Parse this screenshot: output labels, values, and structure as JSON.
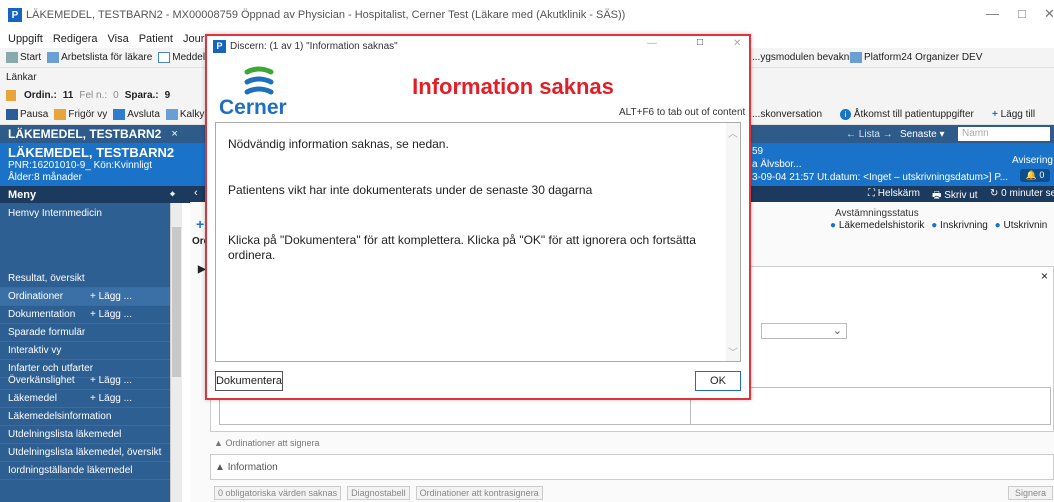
{
  "window": {
    "title": "LÄKEMEDEL, TESTBARN2 - MX00008759 Öppnad av Physician - Hospitalist, Cerner Test (Läkare med (Akutklinik - SÄS))",
    "app_icon": "P",
    "minimize": "—",
    "maximize": "□",
    "close": "✕"
  },
  "menubar": [
    "Uppgift",
    "Redigera",
    "Visa",
    "Patient",
    "Journal"
  ],
  "toolbar1": {
    "items": [
      "Start",
      "Arbetslista för läkare",
      "Meddeland"
    ],
    "right_items": [
      "...ygsmodulen bevakning",
      "Platform24 Organizer DEV"
    ]
  },
  "toolbar2": {
    "label": "Länkar"
  },
  "toolbar3": {
    "ordin_label": "Ordin.:",
    "ordin_value": "11",
    "feln_label": "Fel n.:",
    "feln_value": "0",
    "spara_label": "Spara.:",
    "spara_value": "9"
  },
  "toolbar4": {
    "items": [
      "Pausa",
      "Frigör vy",
      "Avsluta",
      "Kalkylato"
    ],
    "right_items": [
      "...skonversation",
      "Åtkomst till patientuppgifter",
      "Lägg till"
    ]
  },
  "patient_tab": {
    "name": "LÄKEMEDEL, TESTBARN2",
    "close": "×"
  },
  "nav": {
    "list": "Lista",
    "recent": "Senaste",
    "search_placeholder": "Namn"
  },
  "patient_banner": {
    "name": "LÄKEMEDEL, TESTBARN2",
    "pnr": "PNR:16201010-9_ Kön:Kvinnligt",
    "age": "Ålder:8 månader",
    "right_num": "59",
    "right_loc": "a Älvsbor...",
    "right_dates": "3-09-04 21:57 Ut.datum: <Inget – utskrivningsdatum>] P...",
    "avisering": "Avisering",
    "notif_count": "0"
  },
  "sidebar": {
    "header": "Meny",
    "pin": "⌖",
    "items": [
      {
        "label": "Hemvy Internmedicin",
        "plus": ""
      },
      {
        "label": "Resultat, översikt",
        "plus": ""
      },
      {
        "label": "Ordinationer",
        "plus": "+ Lägg ..."
      },
      {
        "label": "Dokumentation",
        "plus": "+ Lägg ..."
      },
      {
        "label": "Sparade formulär",
        "plus": ""
      },
      {
        "label": "Interaktiv vy",
        "plus": ""
      },
      {
        "label": "Infarter och utfarter",
        "plus": ""
      },
      {
        "label": "Överkänslighet",
        "plus": "+ Lägg ..."
      },
      {
        "label": "Läkemedel",
        "plus": "+ Lägg ..."
      },
      {
        "label": "Läkemedelsinformation",
        "plus": ""
      },
      {
        "label": "Utdelningslista läkemedel",
        "plus": ""
      },
      {
        "label": "Utdelningslista läkemedel, översikt",
        "plus": ""
      },
      {
        "label": "Iordningställande läkemedel",
        "plus": ""
      }
    ]
  },
  "content_toolbar": {
    "fullscreen": "Helskärm",
    "print": "Skriv ut",
    "minutes": "0 minuter se"
  },
  "reconciliation": {
    "label": "Avstämningsstatus",
    "items": [
      "Läkemedelshistorik",
      "Inskrivning",
      "Utskrivnin"
    ]
  },
  "content": {
    "ord_tab": "Ord",
    "sign_section": "Ordinationer att signera",
    "info_section": "Information",
    "bottom_buttons": [
      "0 obligatoriska värden saknas",
      "Diagnostabell",
      "Ordinationer att kontrasignera"
    ],
    "sign_button": "Signera"
  },
  "dialog": {
    "title": "Discern: (1 av 1) \"Information saknas\"",
    "heading": "Information saknas",
    "logo_text": "Cerner",
    "hint": "ALT+F6 to tab out of content",
    "messages": [
      "Nödvändig information saknas, se nedan.",
      "Patientens vikt har inte dokumenterats under de senaste 30 dagarna",
      "Klicka på \"Dokumentera\" för att komplettera. Klicka på \"OK\" för att ignorera och fortsätta ordinera."
    ],
    "btn_document": "Dokumentera",
    "btn_ok": "OK",
    "colors": {
      "heading": "#e41e26",
      "border": "#e0343d",
      "logo_blue": "#1f6fbf",
      "logo_green": "#3aa935"
    }
  }
}
